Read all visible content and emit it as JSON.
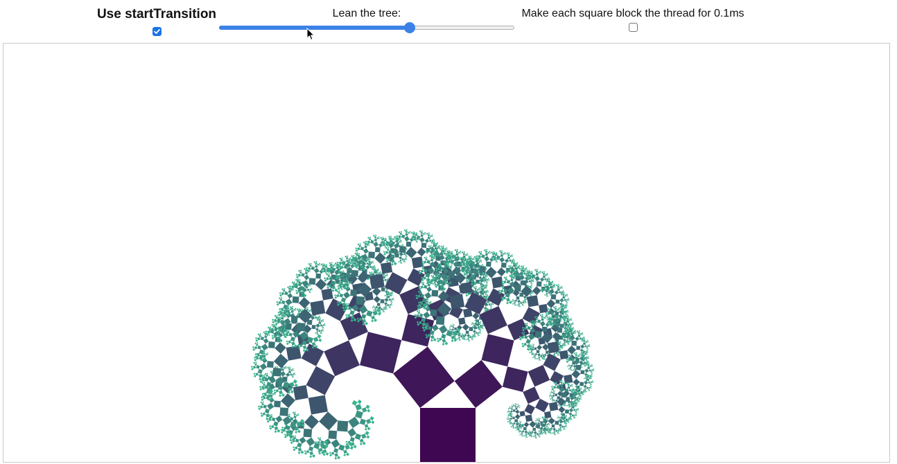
{
  "controls": {
    "transition": {
      "label": "Use startTransition",
      "checked": true
    },
    "lean": {
      "label": "Lean the tree:",
      "value": 0.65
    },
    "block": {
      "label": "Make each square block the thread for 0.1ms",
      "checked": false
    }
  },
  "tree": {
    "colors": {
      "trunk": "#3f0652",
      "leaf": "#3bb38e",
      "check_fill": "#1a73e8",
      "slider_fill": "#3b82e6"
    }
  }
}
